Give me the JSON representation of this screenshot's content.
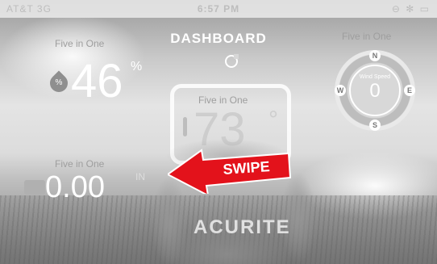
{
  "status_bar": {
    "carrier": "AT&T 3G",
    "time": "6:57 PM",
    "right": "⊖ ✻ ▭"
  },
  "header": {
    "title": "DASHBOARD"
  },
  "tiles": {
    "humidity": {
      "label": "Five in One",
      "value": "46",
      "unit": "%",
      "icon_text": "%"
    },
    "wind": {
      "label": "Five in One",
      "speed_label": "Wind Speed",
      "value": "0",
      "directions": [
        "N",
        "E",
        "S",
        "W"
      ]
    },
    "temperature": {
      "label": "Five in One",
      "value": "73",
      "unit": "°"
    },
    "rain": {
      "label": "Five in One",
      "value": "0.00",
      "unit": "IN"
    }
  },
  "overlay": {
    "swipe_text": "SWIPE"
  },
  "brand": {
    "text": "ACURITE"
  },
  "colors": {
    "arrow": "#e3121b",
    "text": "#ffffff"
  }
}
